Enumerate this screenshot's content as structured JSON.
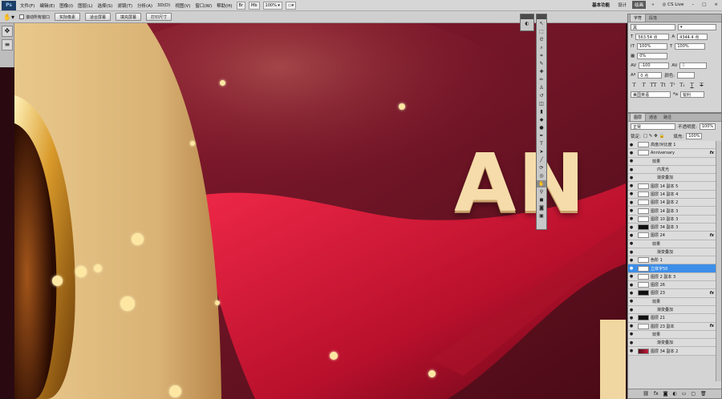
{
  "menubar": {
    "logo": "Ps",
    "items": [
      "文件(F)",
      "编辑(E)",
      "图像(I)",
      "图层(L)",
      "选择(S)",
      "滤镜(T)",
      "分析(A)",
      "3D(D)",
      "视图(V)",
      "窗口(W)",
      "帮助(H)"
    ],
    "zoom": "100%",
    "workspace_basic": "基本功能",
    "workspace_design": "设计",
    "workspace_paint": "绘画",
    "cs_live": "CS Live"
  },
  "options": {
    "scroll_all": "滚动所有窗口",
    "actual_pixels": "实际像素",
    "fit_screen": "适合屏幕",
    "fill_screen": "填充屏幕",
    "print_size": "打印尺寸"
  },
  "canvas": {
    "big_text": "AN"
  },
  "character": {
    "tab_char": "字符",
    "tab_para": "段落",
    "font_style": "黑",
    "font_size": "563.54 点",
    "leading": "4344.4 点",
    "vscale": "100%",
    "hscale": "100%",
    "baseline_shift": "0%",
    "tracking": "-100",
    "kerning": "0",
    "shift_pt": "0 点",
    "color_label": "颜色:",
    "language": "美国英语",
    "aa": "锐利"
  },
  "layers": {
    "tab_layers": "图层",
    "tab_channels": "通道",
    "tab_paths": "路径",
    "blend_mode": "正常",
    "opacity_label": "不透明度:",
    "opacity": "100%",
    "lock_label": "锁定:",
    "fill_label": "填充:",
    "fill": "100%",
    "rows": [
      {
        "name": "高度/对比度 1",
        "kind": "adj"
      },
      {
        "name": "Anniversary",
        "kind": "layer",
        "fx": "fx"
      },
      {
        "name": "效果",
        "kind": "eff"
      },
      {
        "name": "内发光",
        "kind": "sub"
      },
      {
        "name": "渐变叠加",
        "kind": "sub"
      },
      {
        "name": "图层 14 副本 5",
        "kind": "layer"
      },
      {
        "name": "图层 14 副本 4",
        "kind": "layer"
      },
      {
        "name": "图层 14 副本 2",
        "kind": "layer"
      },
      {
        "name": "图层 14 副本 3",
        "kind": "layer"
      },
      {
        "name": "图层 10 副本 3",
        "kind": "layer"
      },
      {
        "name": "图层 34 副本 3",
        "kind": "mask"
      },
      {
        "name": "图层 24",
        "kind": "layer",
        "fx": "fx"
      },
      {
        "name": "效果",
        "kind": "eff"
      },
      {
        "name": "渐变叠加",
        "kind": "sub"
      },
      {
        "name": "色阶 1",
        "kind": "adj"
      },
      {
        "name": "立体字50",
        "kind": "sel"
      },
      {
        "name": "图层 2 副本 3",
        "kind": "layer"
      },
      {
        "name": "图层 26",
        "kind": "layer"
      },
      {
        "name": "图层 23",
        "kind": "mask",
        "fx": "fx"
      },
      {
        "name": "效果",
        "kind": "eff"
      },
      {
        "name": "渐变叠加",
        "kind": "sub"
      },
      {
        "name": "图层 21",
        "kind": "mask"
      },
      {
        "name": "图层 23 副本",
        "kind": "layer",
        "fx": "fx"
      },
      {
        "name": "效果",
        "kind": "eff"
      },
      {
        "name": "渐变叠加",
        "kind": "sub"
      },
      {
        "name": "图层 34 副本 2",
        "kind": "img"
      }
    ]
  }
}
